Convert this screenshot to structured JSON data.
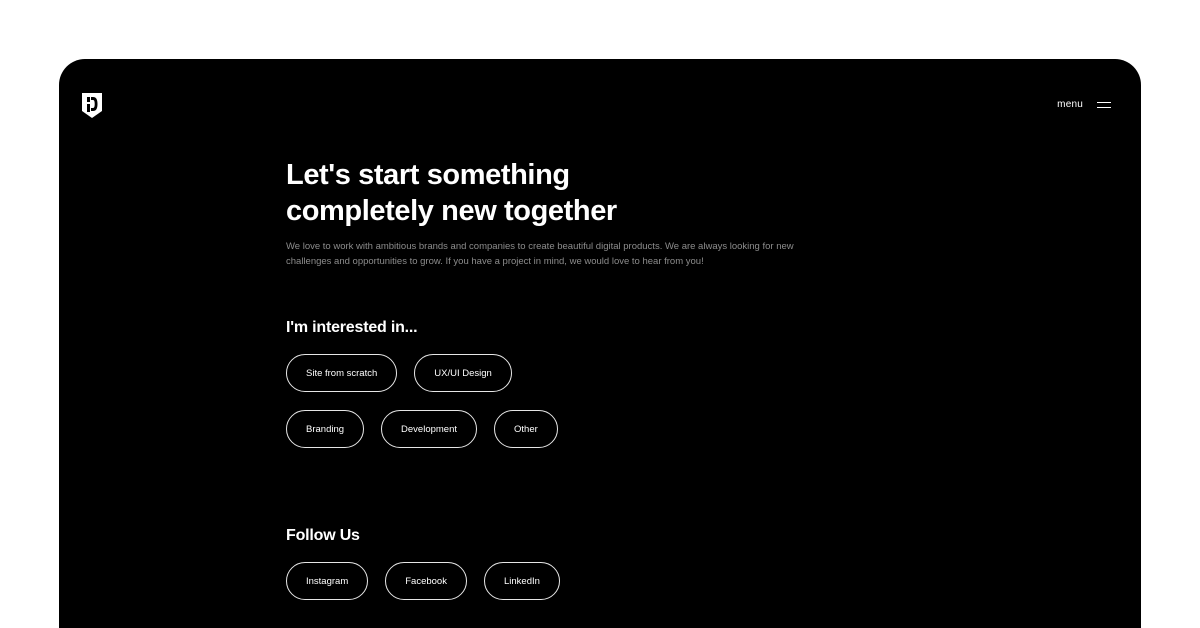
{
  "header": {
    "menu_label": "menu"
  },
  "hero": {
    "headline_line1": "Let's start something",
    "headline_line2": "completely new together",
    "intro_line1": "We love to work with ambitious brands and companies to create beautiful digital products. We are always looking for new",
    "intro_line2": "challenges and opportunities to grow. If you have a project in mind, we would love to hear from you!"
  },
  "interests": {
    "title": "I'm interested in...",
    "row1": [
      "Site from scratch",
      "UX/UI Design"
    ],
    "row2": [
      "Branding",
      "Development",
      "Other"
    ]
  },
  "follow": {
    "title": "Follow Us",
    "links": [
      "Instagram",
      "Facebook",
      "LinkedIn"
    ]
  },
  "colors": {
    "background": "#000000",
    "text": "#ffffff",
    "muted_text": "#8c8c8c",
    "chip_border": "#e6e6e6"
  },
  "icons": {
    "logo": "shield-logo-icon",
    "menu": "hamburger-menu-icon"
  }
}
